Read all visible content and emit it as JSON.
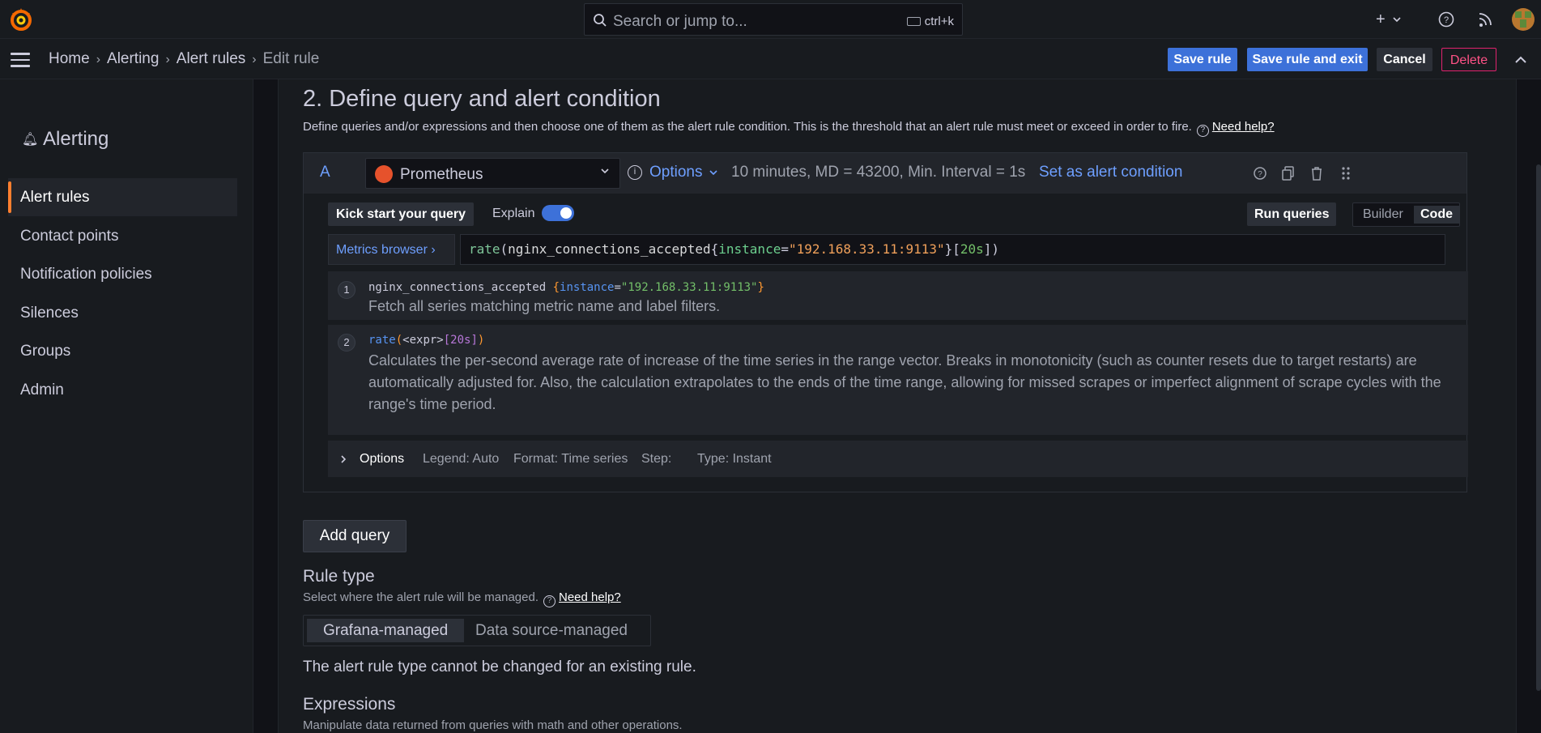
{
  "topbar": {
    "search_placeholder": "Search or jump to...",
    "search_shortcut": "ctrl+k",
    "add_label": "+"
  },
  "breadcrumb": {
    "items": [
      "Home",
      "Alerting",
      "Alert rules"
    ],
    "current": "Edit rule"
  },
  "actions": {
    "save": "Save rule",
    "save_exit": "Save rule and exit",
    "cancel": "Cancel",
    "delete": "Delete"
  },
  "sidebar": {
    "title": "Alerting",
    "items": [
      {
        "label": "Alert rules",
        "active": true
      },
      {
        "label": "Contact points"
      },
      {
        "label": "Notification policies"
      },
      {
        "label": "Silences"
      },
      {
        "label": "Groups"
      },
      {
        "label": "Admin"
      }
    ]
  },
  "section": {
    "title": "2. Define query and alert condition",
    "description": "Define queries and/or expressions and then choose one of them as the alert rule condition. This is the threshold that an alert rule must meet or exceed in order to fire.",
    "help": "Need help?"
  },
  "query": {
    "ref": "A",
    "datasource": "Prometheus",
    "options_label": "Options",
    "info": "10 minutes, MD = 43200, Min. Interval = 1s",
    "set_condition": "Set as alert condition",
    "kick_start": "Kick start your query",
    "explain_label": "Explain",
    "explain_on": true,
    "run_queries": "Run queries",
    "modes": [
      "Builder",
      "Code"
    ],
    "active_mode": "Code",
    "metrics_browser": "Metrics browser",
    "expr": {
      "fn": "rate",
      "metric": "nginx_connections_accepted",
      "label_key": "instance",
      "label_value": "\"192.168.33.11:9113\"",
      "range": "20s"
    },
    "explain_steps": [
      {
        "num": "1",
        "metric": "nginx_connections_accepted",
        "label_key": "instance",
        "label_value": "\"192.168.33.11:9113\"",
        "text": "Fetch all series matching metric name and label filters."
      },
      {
        "num": "2",
        "fn": "rate",
        "expr": "<expr>",
        "range": "[20s]",
        "text": "Calculates the per-second average rate of increase of the time series in the range vector. Breaks in monotonicity (such as counter resets due to target restarts) are automatically adjusted for. Also, the calculation extrapolates to the ends of the time range, allowing for missed scrapes or imperfect alignment of scrape cycles with the range's time period."
      }
    ],
    "footer": {
      "options": "Options",
      "legend": "Legend: Auto",
      "format": "Format: Time series",
      "step": "Step:",
      "type": "Type: Instant"
    }
  },
  "add_query": "Add query",
  "rule_type": {
    "title": "Rule type",
    "description": "Select where the alert rule will be managed.",
    "help": "Need help?",
    "options": [
      "Grafana-managed",
      "Data source-managed"
    ],
    "selected": "Grafana-managed",
    "note": "The alert rule type cannot be changed for an existing rule."
  },
  "expressions": {
    "title": "Expressions",
    "description": "Manipulate data returned from queries with math and other operations."
  },
  "colors": {
    "primary": "#3d71d9",
    "link": "#6e9fff",
    "danger": "#ff5286",
    "active_accent": "#ff7f2f",
    "prometheus": "#e6522c"
  }
}
